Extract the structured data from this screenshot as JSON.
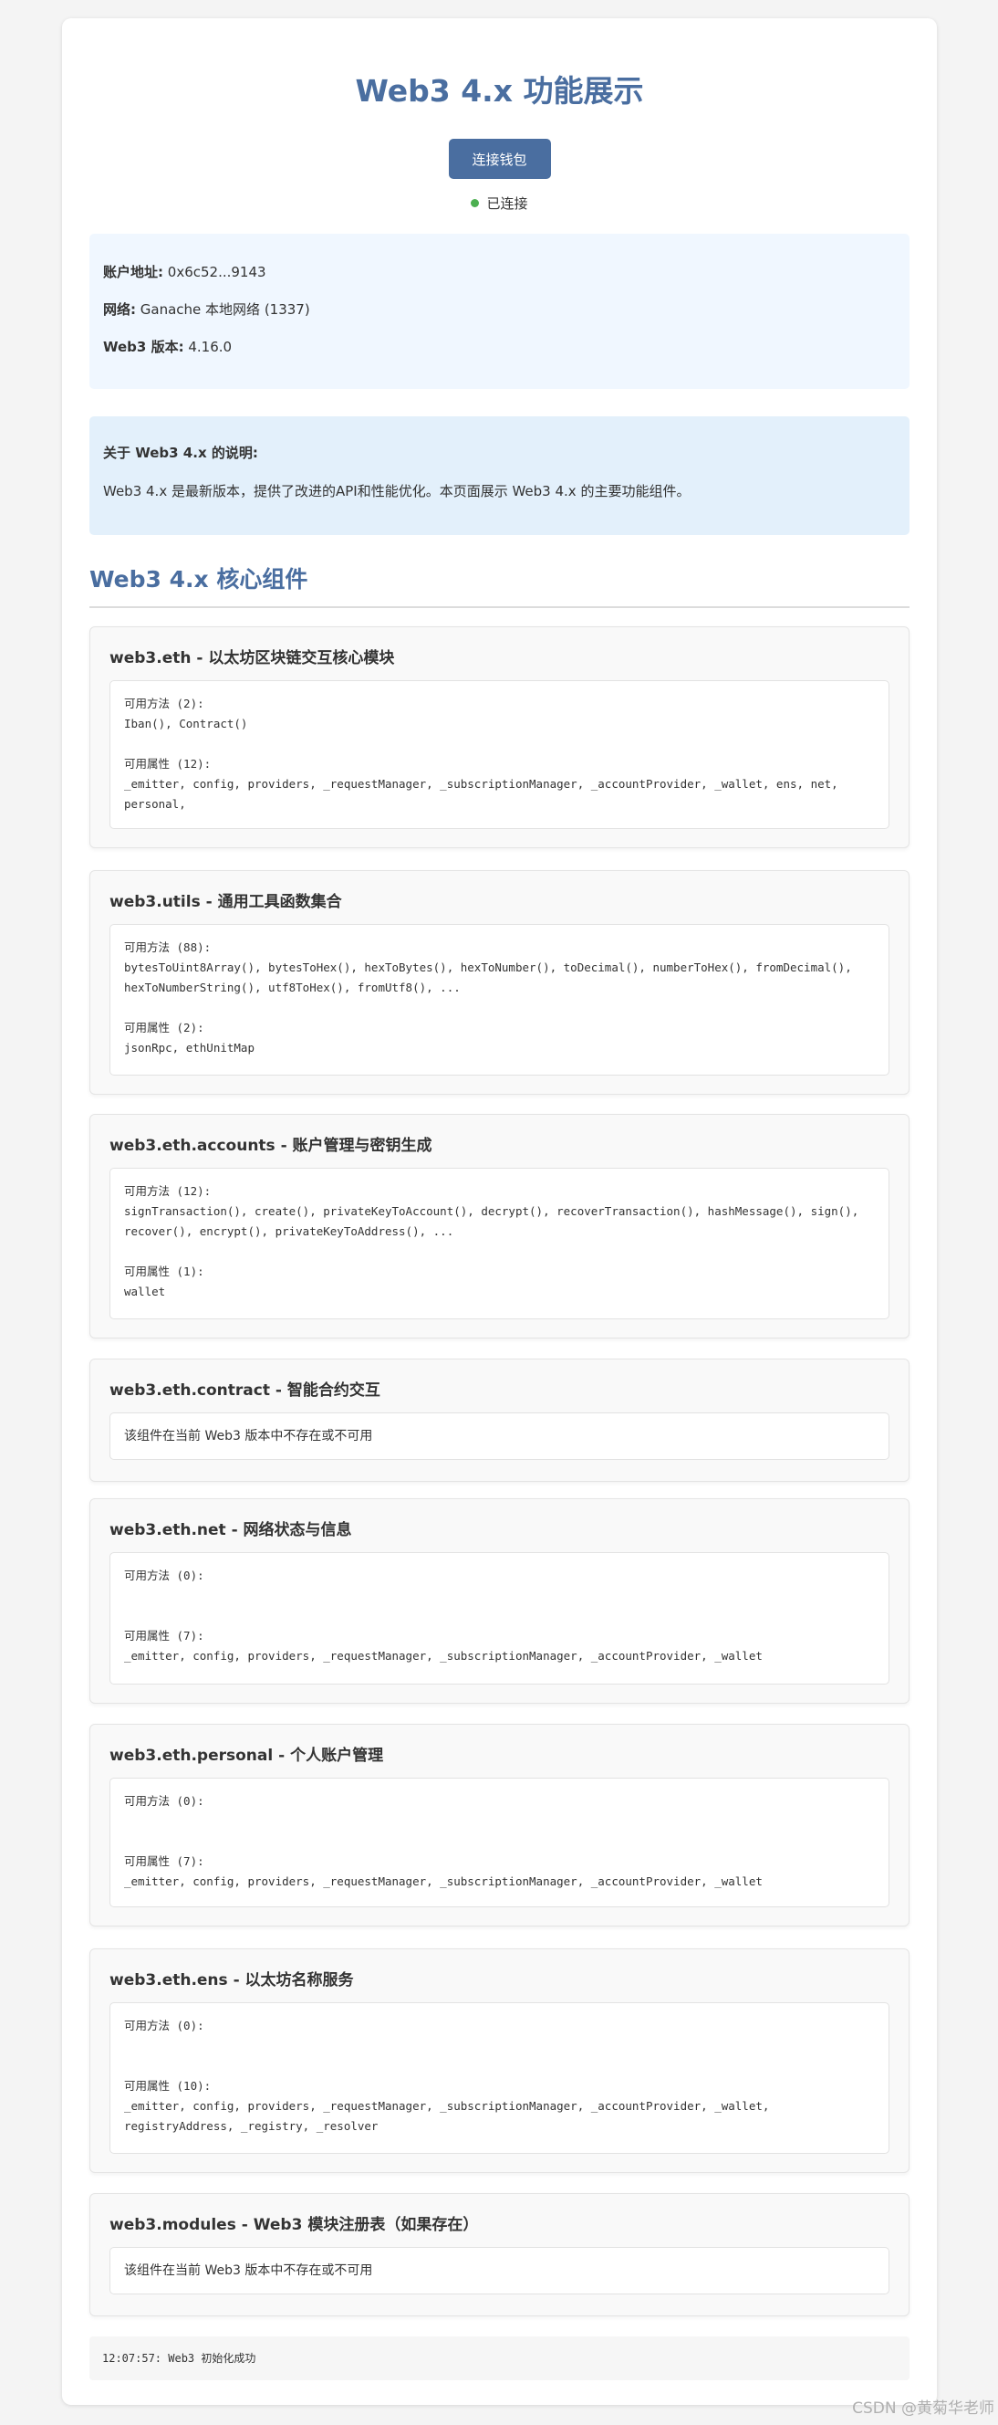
{
  "header": {
    "title": "Web3 4.x 功能展示",
    "connect_button": "连接钱包",
    "status": "已连接"
  },
  "account_info": [
    {
      "label": "账户地址:",
      "value": "0x6c52...9143"
    },
    {
      "label": "网络:",
      "value": "Ganache 本地网络 (1337)"
    },
    {
      "label": "Web3 版本:",
      "value": "4.16.0"
    }
  ],
  "note": {
    "title": "关于 Web3 4.x 的说明:",
    "text": "Web3 4.x 是最新版本，提供了改进的API和性能优化。本页面展示 Web3 4.x 的主要功能组件。"
  },
  "section_title": "Web3 4.x 核心组件",
  "components": [
    {
      "title": "web3.eth - 以太坊区块链交互核心模块",
      "methods_label": "可用方法 (2):",
      "methods": "Iban(), Contract()",
      "props_label": "可用属性 (12):",
      "props": "_emitter, config, providers, _requestManager, _subscriptionManager, _accountProvider, _wallet, ens, net, personal,"
    },
    {
      "title": "web3.utils - 通用工具函数集合",
      "methods_label": "可用方法 (88):",
      "methods": "bytesToUint8Array(), bytesToHex(), hexToBytes(), hexToNumber(), toDecimal(), numberToHex(), fromDecimal(), hexToNumberString(), utf8ToHex(), fromUtf8(), ...",
      "props_label": "可用属性 (2):",
      "props": "jsonRpc, ethUnitMap"
    },
    {
      "title": "web3.eth.accounts - 账户管理与密钥生成",
      "methods_label": "可用方法 (12):",
      "methods": "signTransaction(), create(), privateKeyToAccount(), decrypt(), recoverTransaction(), hashMessage(), sign(), recover(), encrypt(), privateKeyToAddress(), ...",
      "props_label": "可用属性 (1):",
      "props": "wallet"
    },
    {
      "title": "web3.eth.contract - 智能合约交互",
      "unavailable": "该组件在当前 Web3 版本中不存在或不可用"
    },
    {
      "title": "web3.eth.net - 网络状态与信息",
      "methods_label": "可用方法 (0):",
      "methods": "",
      "props_label": "可用属性 (7):",
      "props": "_emitter, config, providers, _requestManager, _subscriptionManager, _accountProvider, _wallet"
    },
    {
      "title": "web3.eth.personal - 个人账户管理",
      "methods_label": "可用方法 (0):",
      "methods": "",
      "props_label": "可用属性 (7):",
      "props": "_emitter, config, providers, _requestManager, _subscriptionManager, _accountProvider, _wallet"
    },
    {
      "title": "web3.eth.ens - 以太坊名称服务",
      "methods_label": "可用方法 (0):",
      "methods": "",
      "props_label": "可用属性 (10):",
      "props": "_emitter, config, providers, _requestManager, _subscriptionManager, _accountProvider, _wallet, registryAddress, _registry, _resolver"
    },
    {
      "title": "web3.modules - Web3 模块注册表（如果存在）",
      "unavailable": "该组件在当前 Web3 版本中不存在或不可用"
    }
  ],
  "log": "12:07:57: Web3 初始化成功",
  "watermark": "CSDN @黄菊华老师",
  "colors": {
    "accent": "#4a6ea0",
    "status_dot": "#4caf50"
  }
}
